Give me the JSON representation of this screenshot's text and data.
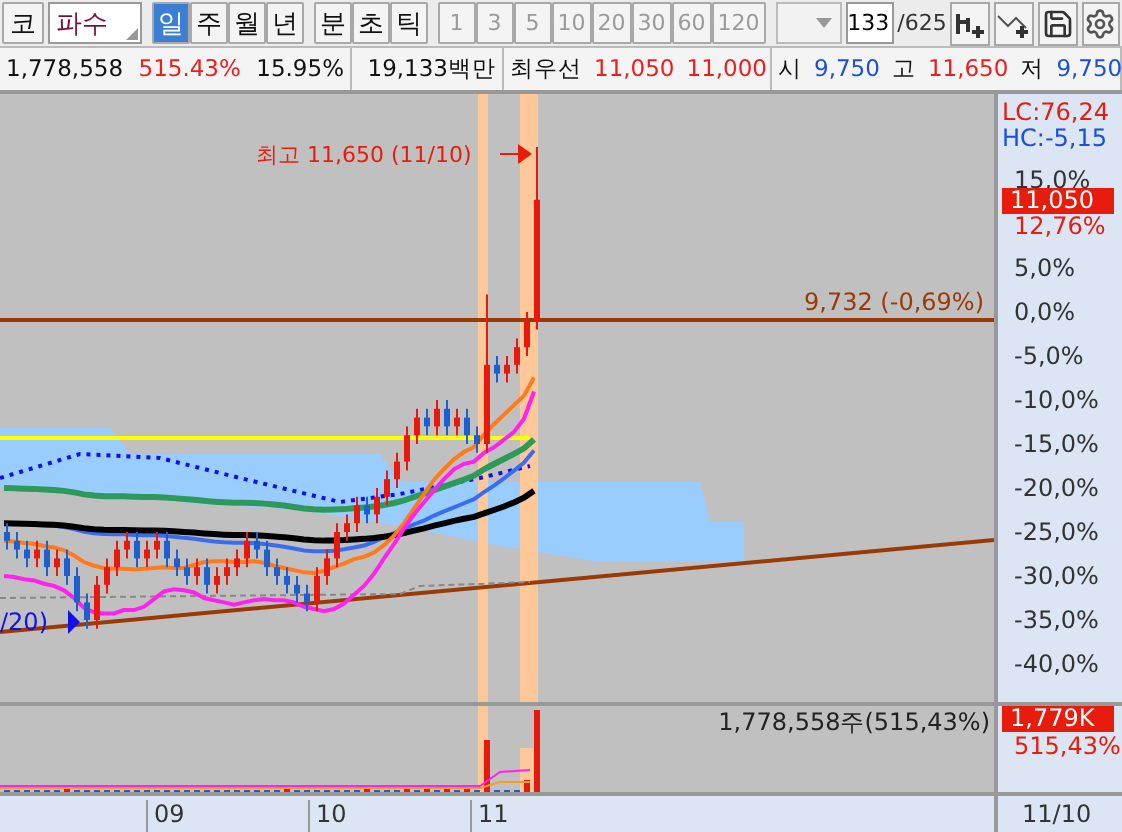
{
  "toolbar": {
    "market_button": "코",
    "stock_name": "파수",
    "periods": [
      {
        "label": "일",
        "selected": true
      },
      {
        "label": "주",
        "selected": false
      },
      {
        "label": "월",
        "selected": false
      },
      {
        "label": "년",
        "selected": false
      }
    ],
    "intraday": [
      {
        "label": "분",
        "selected": false
      },
      {
        "label": "초",
        "selected": false
      },
      {
        "label": "틱",
        "selected": false
      }
    ],
    "intervals": [
      {
        "label": "1",
        "disabled": true
      },
      {
        "label": "3",
        "disabled": true
      },
      {
        "label": "5",
        "disabled": true
      },
      {
        "label": "10",
        "disabled": true
      },
      {
        "label": "20",
        "disabled": true
      },
      {
        "label": "30",
        "disabled": true
      },
      {
        "label": "60",
        "disabled": true
      },
      {
        "label": "120",
        "disabled": true
      }
    ],
    "count": "133",
    "total": "/625"
  },
  "info_bar": {
    "volume": "1,778,558",
    "volume_ratio": "515.43%",
    "turnover": "15.95%",
    "amount": "19,133백만",
    "best_label": "최우선",
    "ask": "11,050",
    "bid": "11,000",
    "quotes": [
      {
        "label": "시",
        "value": "9,750",
        "color": "#1a4fd8"
      },
      {
        "label": "고",
        "value": "11,650",
        "color": "#ee1c1c"
      },
      {
        "label": "저",
        "value": "9,750",
        "color": "#1a4fd8"
      }
    ]
  },
  "price_chart": {
    "high_note": "최고 11,650 (11/10)",
    "base_line_label": "9,732 (-0,69%)",
    "ma_label": "/20)",
    "lc": "LC:76,24",
    "hc": "HC:-5,15",
    "axis_labels": [
      "15,0%",
      "5,0%",
      "0,0%",
      "-5,0%",
      "-10,0%",
      "-15,0%",
      "-20,0%",
      "-25,0%",
      "-30,0%",
      "-35,0%",
      "-40,0%"
    ],
    "current_price": "11,050",
    "current_change": "12,76%"
  },
  "volume_chart": {
    "label": "1,778,558주(515,43%)",
    "current": "1,779K",
    "ratio": "515,43%"
  },
  "x_axis": {
    "labels": [
      "09",
      "10",
      "11"
    ],
    "date": "11/10"
  }
}
